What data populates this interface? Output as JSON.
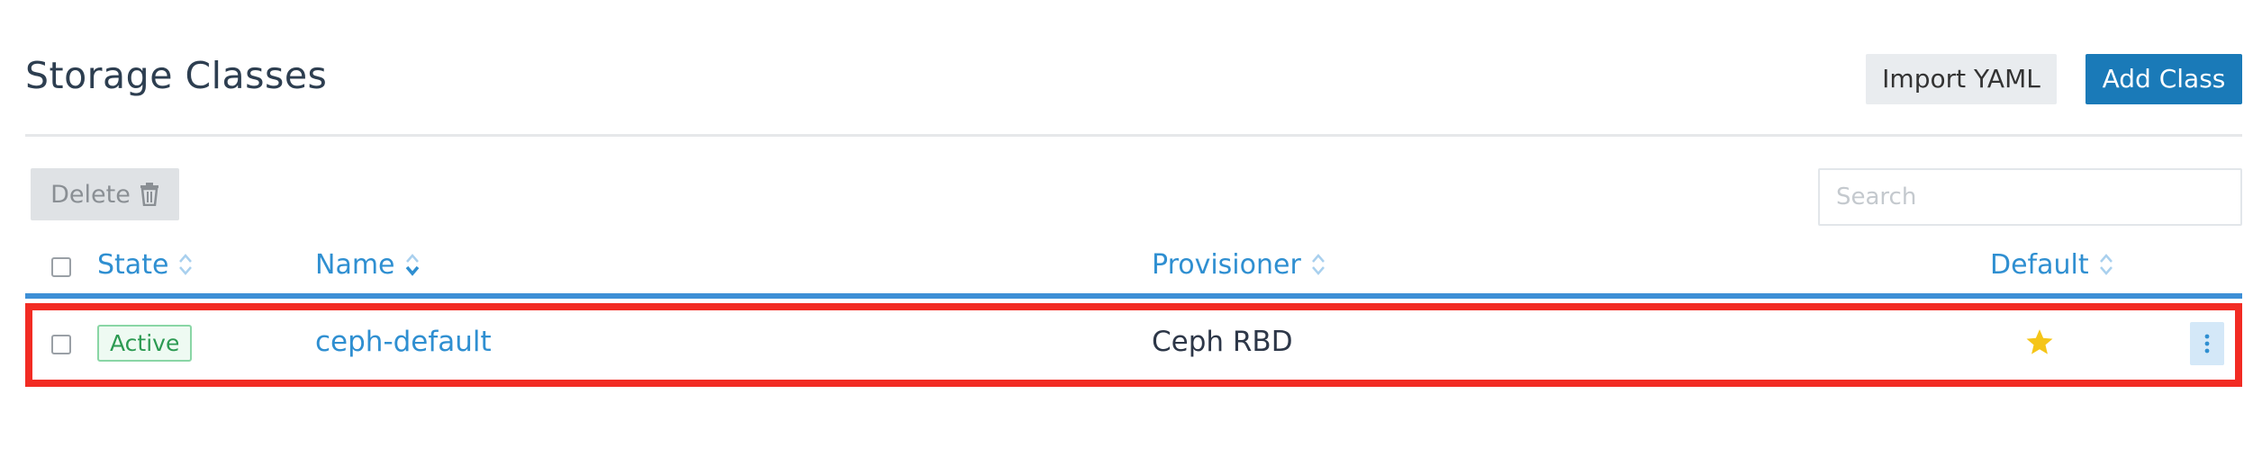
{
  "header": {
    "title": "Storage Classes",
    "import_label": "Import YAML",
    "add_label": "Add Class"
  },
  "toolbar": {
    "delete_label": "Delete",
    "search_placeholder": "Search"
  },
  "table": {
    "columns": [
      "State",
      "Name",
      "Provisioner",
      "Default"
    ],
    "rows": [
      {
        "state": "Active",
        "name": "ceph-default",
        "provisioner": "Ceph RBD",
        "default": true
      }
    ]
  },
  "colors": {
    "primary": "#1a7ab8",
    "link": "#2f8fd1",
    "highlight": "#f22b23",
    "active_badge": "#2c9a52",
    "star": "#f5c518"
  },
  "icons": {
    "delete": "trash-icon",
    "sort": "sort-icon",
    "default": "star-icon",
    "actions": "kebab-menu-icon"
  }
}
